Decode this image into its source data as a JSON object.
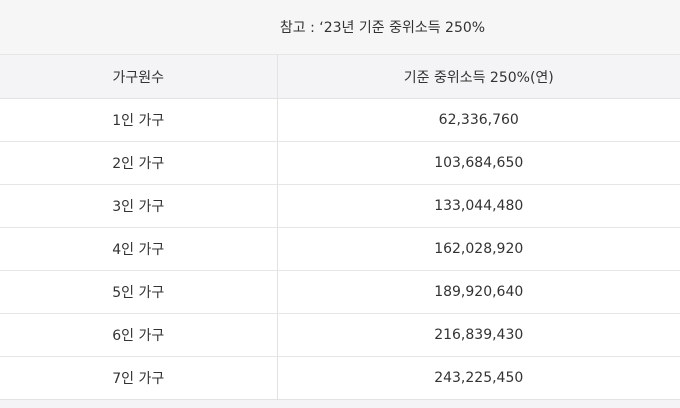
{
  "note": "참고 : ‘23년 기준 중위소득 250%",
  "table": {
    "headers": [
      "가구원수",
      "기준 중위소득 250%(연)"
    ],
    "rows": [
      [
        "1인 가구",
        "62,336,760"
      ],
      [
        "2인 가구",
        "103,684,650"
      ],
      [
        "3인 가구",
        "133,044,480"
      ],
      [
        "4인 가구",
        "162,028,920"
      ],
      [
        "5인 가구",
        "189,920,640"
      ],
      [
        "6인 가구",
        "216,839,430"
      ],
      [
        "7인 가구",
        "243,225,450"
      ]
    ]
  }
}
